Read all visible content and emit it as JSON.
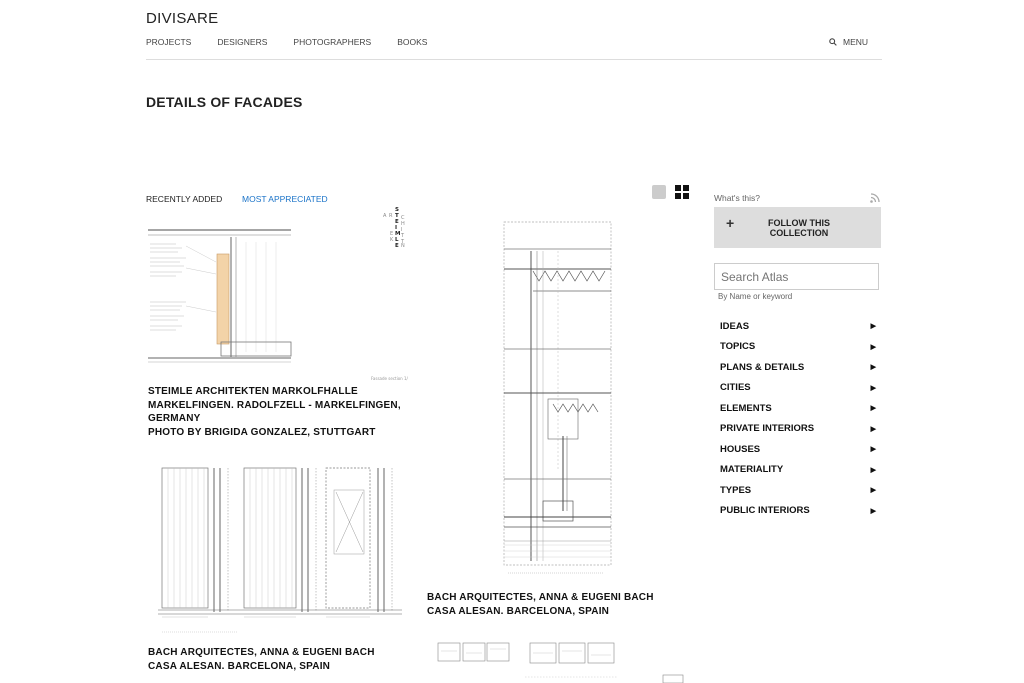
{
  "header": {
    "logo": "DIVISARE",
    "nav": [
      "PROJECTS",
      "DESIGNERS",
      "PHOTOGRAPHERS",
      "BOOKS"
    ],
    "menu_label": "MENU"
  },
  "page_title": "DETAILS OF FACADES",
  "sort": {
    "recent": "RECENTLY ADDED",
    "most": "MOST APPRECIATED"
  },
  "colors": {
    "accent": "#1a73c8",
    "button_bg": "#dddddd",
    "text": "#222222"
  },
  "cards": [
    {
      "lines": [
        "STEIMLE ARCHITEKTEN MARKOLFHALLE",
        "MARKELFINGEN. RADOLFZELL - MARKELFINGEN,",
        "GERMANY",
        "PHOTO BY BRIGIDA GONZALEZ, STUTTGART"
      ]
    },
    {
      "lines": [
        "BACH ARQUITECTES, ANNA & EUGENI BACH",
        "CASA ALESAN. BARCELONA, SPAIN"
      ]
    },
    {
      "lines": [
        "BACH ARQUITECTES, ANNA & EUGENI BACH",
        "CASA ALESAN. BARCELONA, SPAIN"
      ]
    }
  ],
  "sidebar": {
    "whats_this": "What's this?",
    "follow_label": "FOLLOW THIS COLLECTION",
    "search_placeholder": "Search Atlas",
    "search_hint": "By Name or keyword",
    "categories": [
      "IDEAS",
      "TOPICS",
      "PLANS & DETAILS",
      "CITIES",
      "ELEMENTS",
      "PRIVATE INTERIORS",
      "HOUSES",
      "MATERIALITY",
      "TYPES",
      "PUBLIC INTERIORS"
    ]
  },
  "icons": {
    "search": "search-icon",
    "rss": "rss-icon",
    "plus": "plus-icon",
    "chevron": "chevron-right-icon"
  }
}
